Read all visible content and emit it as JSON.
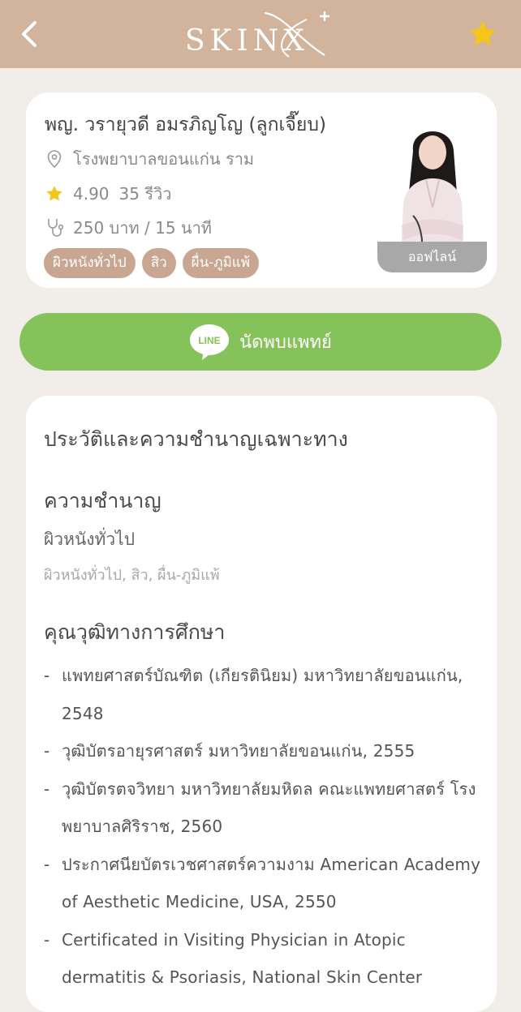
{
  "header": {
    "logo": "SKINX",
    "icons": {
      "back": "chevron-left-icon",
      "favorite": "star-icon"
    },
    "colors": {
      "background": "#d2b39c",
      "favorite": "#f5c518"
    }
  },
  "doctor": {
    "name": "พญ. วรายุวดี อมรภิญโญ (ลูกเจี๊ยบ)",
    "hospital": "โรงพยาบาลขอนแก่น ราม",
    "rating": "4.90",
    "reviews": "35 รีวิว",
    "fee": "250 บาท / 15 นาที",
    "tags": [
      "ผิวหนังทั่วไป",
      "สิว",
      "ผื่น-ภูมิแพ้"
    ],
    "status": "ออฟไลน์"
  },
  "line_button": {
    "icon_text": "LINE",
    "label": "นัดพบแพทย์",
    "color": "#86c25a"
  },
  "history": {
    "title": "ประวัติและความชำนาญเฉพาะทาง",
    "specialty_heading": "ความชำนาญ",
    "specialty_primary": "ผิวหนังทั่วไป",
    "specialty_list": "ผิวหนังทั่วไป, สิว, ผื่น-ภูมิแพ้",
    "education_heading": "คุณวุฒิทางการศึกษา",
    "education": [
      "แพทยศาสตร์บัณฑิต (เกียรตินิยม) มหาวิทยาลัยขอนแก่น, 2548",
      "วุฒิบัตรอายุรศาสตร์ มหาวิทยาลัยขอนแก่น, 2555",
      "วุฒิบัตรตจวิทยา มหาวิทยาลัยมหิดล คณะแพทยศาสตร์ โรงพยาบาลศิริราช, 2560",
      "ประกาศนียบัตรเวชศาสตร์ความงาม American Academy of Aesthetic Medicine, USA, 2550",
      "Certificated in Visiting Physician in Atopic dermatitis & Psoriasis, National Skin Center"
    ]
  }
}
